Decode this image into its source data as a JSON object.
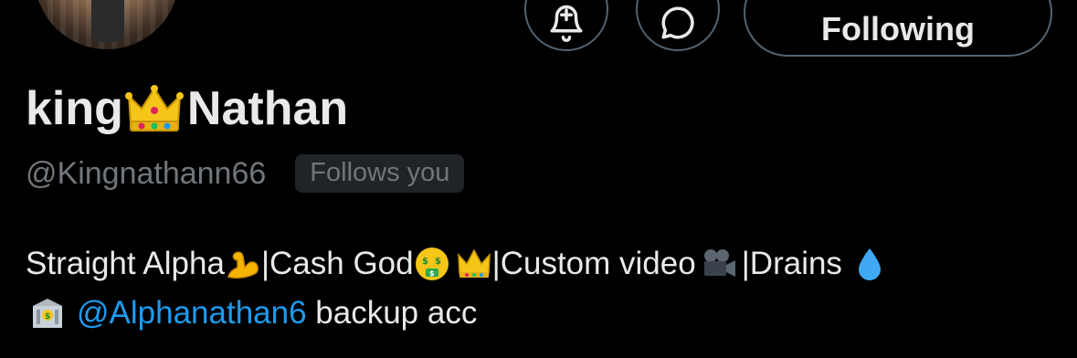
{
  "profile": {
    "name_part1": "king",
    "name_part2": "Nathan",
    "handle": "@Kingnathann66",
    "follows_you": "Follows you"
  },
  "actions": {
    "following_label": "Following"
  },
  "bio": {
    "segment1": "Straight Alpha",
    "segment2": "|Cash God",
    "segment3": "|Custom video",
    "segment4": "|Drains",
    "mention": "@Alphanathan6",
    "backup": " backup acc"
  },
  "icons": {
    "bio_emojis": [
      "flexed-biceps",
      "money-mouth-face",
      "crown",
      "movie-camera",
      "droplet",
      "bank"
    ],
    "name_emoji": "crown"
  },
  "colors": {
    "background": "#000000",
    "text": "#e7e9ea",
    "muted": "#71767b",
    "link": "#1d9bf0",
    "badge_bg": "#202327",
    "border": "#536471"
  }
}
